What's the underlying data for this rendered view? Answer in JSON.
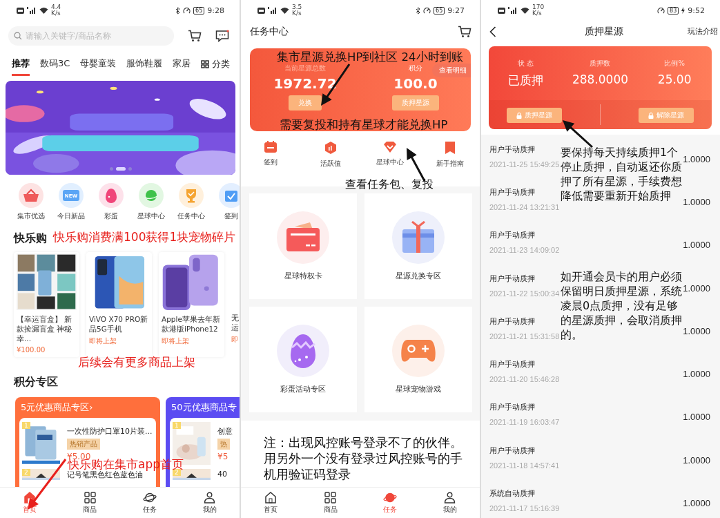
{
  "home": {
    "status_bar": {
      "speed": "4.4",
      "speed_unit": "K/s",
      "bluetooth": true,
      "battery": "65",
      "charging": false,
      "time": "9:28"
    },
    "search": {
      "placeholder": "请输入关键字/商品名称"
    },
    "categories": [
      {
        "label": "推荐",
        "selected": true
      },
      {
        "label": "数码3C",
        "selected": false
      },
      {
        "label": "母婴童装",
        "selected": false
      },
      {
        "label": "服饰鞋履",
        "selected": false
      },
      {
        "label": "家居",
        "selected": false
      }
    ],
    "category_button": "分类",
    "banner": {
      "kind": "picture",
      "dots": [
        {
          "selected": false
        },
        {
          "selected": true
        },
        {
          "selected": false
        }
      ]
    },
    "shortcuts": [
      {
        "label": "集市优选"
      },
      {
        "label": "今日新品",
        "badge": "NEW"
      },
      {
        "label": "彩蛋"
      },
      {
        "label": "星球中心"
      },
      {
        "label": "任务中心"
      },
      {
        "label": "签到"
      }
    ],
    "section_title": "快乐购",
    "products": [
      {
        "title": "【幸运盲盒】 新款捡漏盲盒 神秘幸...",
        "note": "¥100.00"
      },
      {
        "title": "ViVO X70 PRO新品5G手机",
        "note": "即将上架"
      },
      {
        "title": "Apple苹果去年新款港版iPhone12",
        "note": "即将上架"
      },
      {
        "title": "无运",
        "note": "即"
      }
    ],
    "points_title": "积分专区",
    "zones": [
      {
        "title": "5元优惠商品专区",
        "chevron": "›",
        "color": "#ff6f3c",
        "items": [
          {
            "rank": "1",
            "title": "一次性防护口罩10片装...",
            "tag": "热销产品",
            "price": "¥5.00"
          },
          {
            "rank": "2",
            "title": "记号笔黑色红色蓝色油"
          }
        ]
      },
      {
        "title": "50元优惠商品专",
        "color": "#5b4cf2",
        "items": [
          {
            "rank": "1",
            "title": "创意",
            "tag": "热",
            "price": "¥5"
          },
          {
            "rank": "2",
            "title": "40"
          }
        ]
      }
    ],
    "bottom_nav": [
      {
        "label": "首页",
        "selected": true
      },
      {
        "label": "商品",
        "selected": false
      },
      {
        "label": "任务",
        "selected": false
      },
      {
        "label": "我的",
        "selected": false
      }
    ],
    "annotations": [
      {
        "text": "快乐购消费满100获得1块宠物碎片",
        "color": "#e8201c"
      },
      {
        "text": "后续会有更多商品上架",
        "color": "#e8201c"
      },
      {
        "text": "快乐购在集市app首页",
        "color": "#e8201c"
      }
    ]
  },
  "tasks": {
    "status_bar": {
      "speed": "3.5",
      "speed_unit": "K/s",
      "bluetooth": true,
      "battery": "65",
      "charging": false,
      "time": "9:27"
    },
    "title": "任务中心",
    "balance": {
      "label": "当前星源总数",
      "value": "1972.72",
      "button": "兑换"
    },
    "points": {
      "label": "积分",
      "value": "100.0",
      "button": "质押星源"
    },
    "details_button": "查看明细",
    "quick_links": [
      "签到",
      "活跃值",
      "星球中心",
      "新手指南"
    ],
    "features": [
      "星球特权卡",
      "星源兑换专区",
      "彩蛋活动专区",
      "星球宠物游戏"
    ],
    "bottom_nav": [
      {
        "label": "首页",
        "selected": false
      },
      {
        "label": "商品",
        "selected": false
      },
      {
        "label": "任务",
        "selected": true
      },
      {
        "label": "我的",
        "selected": false
      }
    ],
    "annotations": [
      {
        "text": "集市星源兑换HP到社区 24小时到账",
        "color": "#111111"
      },
      {
        "text": "需要复投和持有星球才能兑换HP",
        "color": "#111111"
      },
      {
        "text": "查看任务包、复投",
        "color": "#111111"
      },
      {
        "text": "注：出现风控账号登录不了的伙伴。用另外一个没有登录过风控账号的手机用验证码登录",
        "color": "#111111"
      }
    ]
  },
  "pledge": {
    "status_bar": {
      "speed": "170",
      "speed_unit": "K/s",
      "bluetooth": false,
      "battery": "83",
      "charging": true,
      "time": "9:52"
    },
    "title": "质押星源",
    "help_link": "玩法介绍",
    "stats": [
      {
        "label": "状 态",
        "value": "已质押"
      },
      {
        "label": "质押数",
        "value": "288.0000"
      },
      {
        "label": "比例%",
        "value": "25.00"
      }
    ],
    "actions": [
      "质押星源",
      "解除星源"
    ],
    "records": [
      {
        "title": "用户手动质押",
        "time": "2021-11-25 15:49:25",
        "amount": "1.0000"
      },
      {
        "title": "用户手动质押",
        "time": "2021-11-24 13:21:31",
        "amount": "1.0000"
      },
      {
        "title": "用户手动质押",
        "time": "2021-11-23 14:09:02",
        "amount": "1.0000"
      },
      {
        "title": "用户手动质押",
        "time": "2021-11-22 15:00:34",
        "amount": "1.0000"
      },
      {
        "title": "用户手动质押",
        "time": "2021-11-21 15:31:58",
        "amount": "1.0000"
      },
      {
        "title": "用户手动质押",
        "time": "2021-11-20 15:46:28",
        "amount": "1.0000"
      },
      {
        "title": "用户手动质押",
        "time": "2021-11-19 16:03:47",
        "amount": "1.0000"
      },
      {
        "title": "用户手动质押",
        "time": "2021-11-18 14:57:41",
        "amount": "1.0000"
      },
      {
        "title": "系统自动质押",
        "time": "2021-11-17 15:16:39",
        "amount": "1.0000"
      }
    ],
    "annotations": [
      {
        "text": "要保持每天持续质押1个停止质押，自动返还你质押了所有星源，手续费想降低需要重新开始质押",
        "color": "#111111"
      },
      {
        "text": "如开通会员卡的用户必须保留明日质押星源，系统凌晨0点质押，没有足够的星源质押，会取消质押的。",
        "color": "#111111"
      }
    ]
  }
}
